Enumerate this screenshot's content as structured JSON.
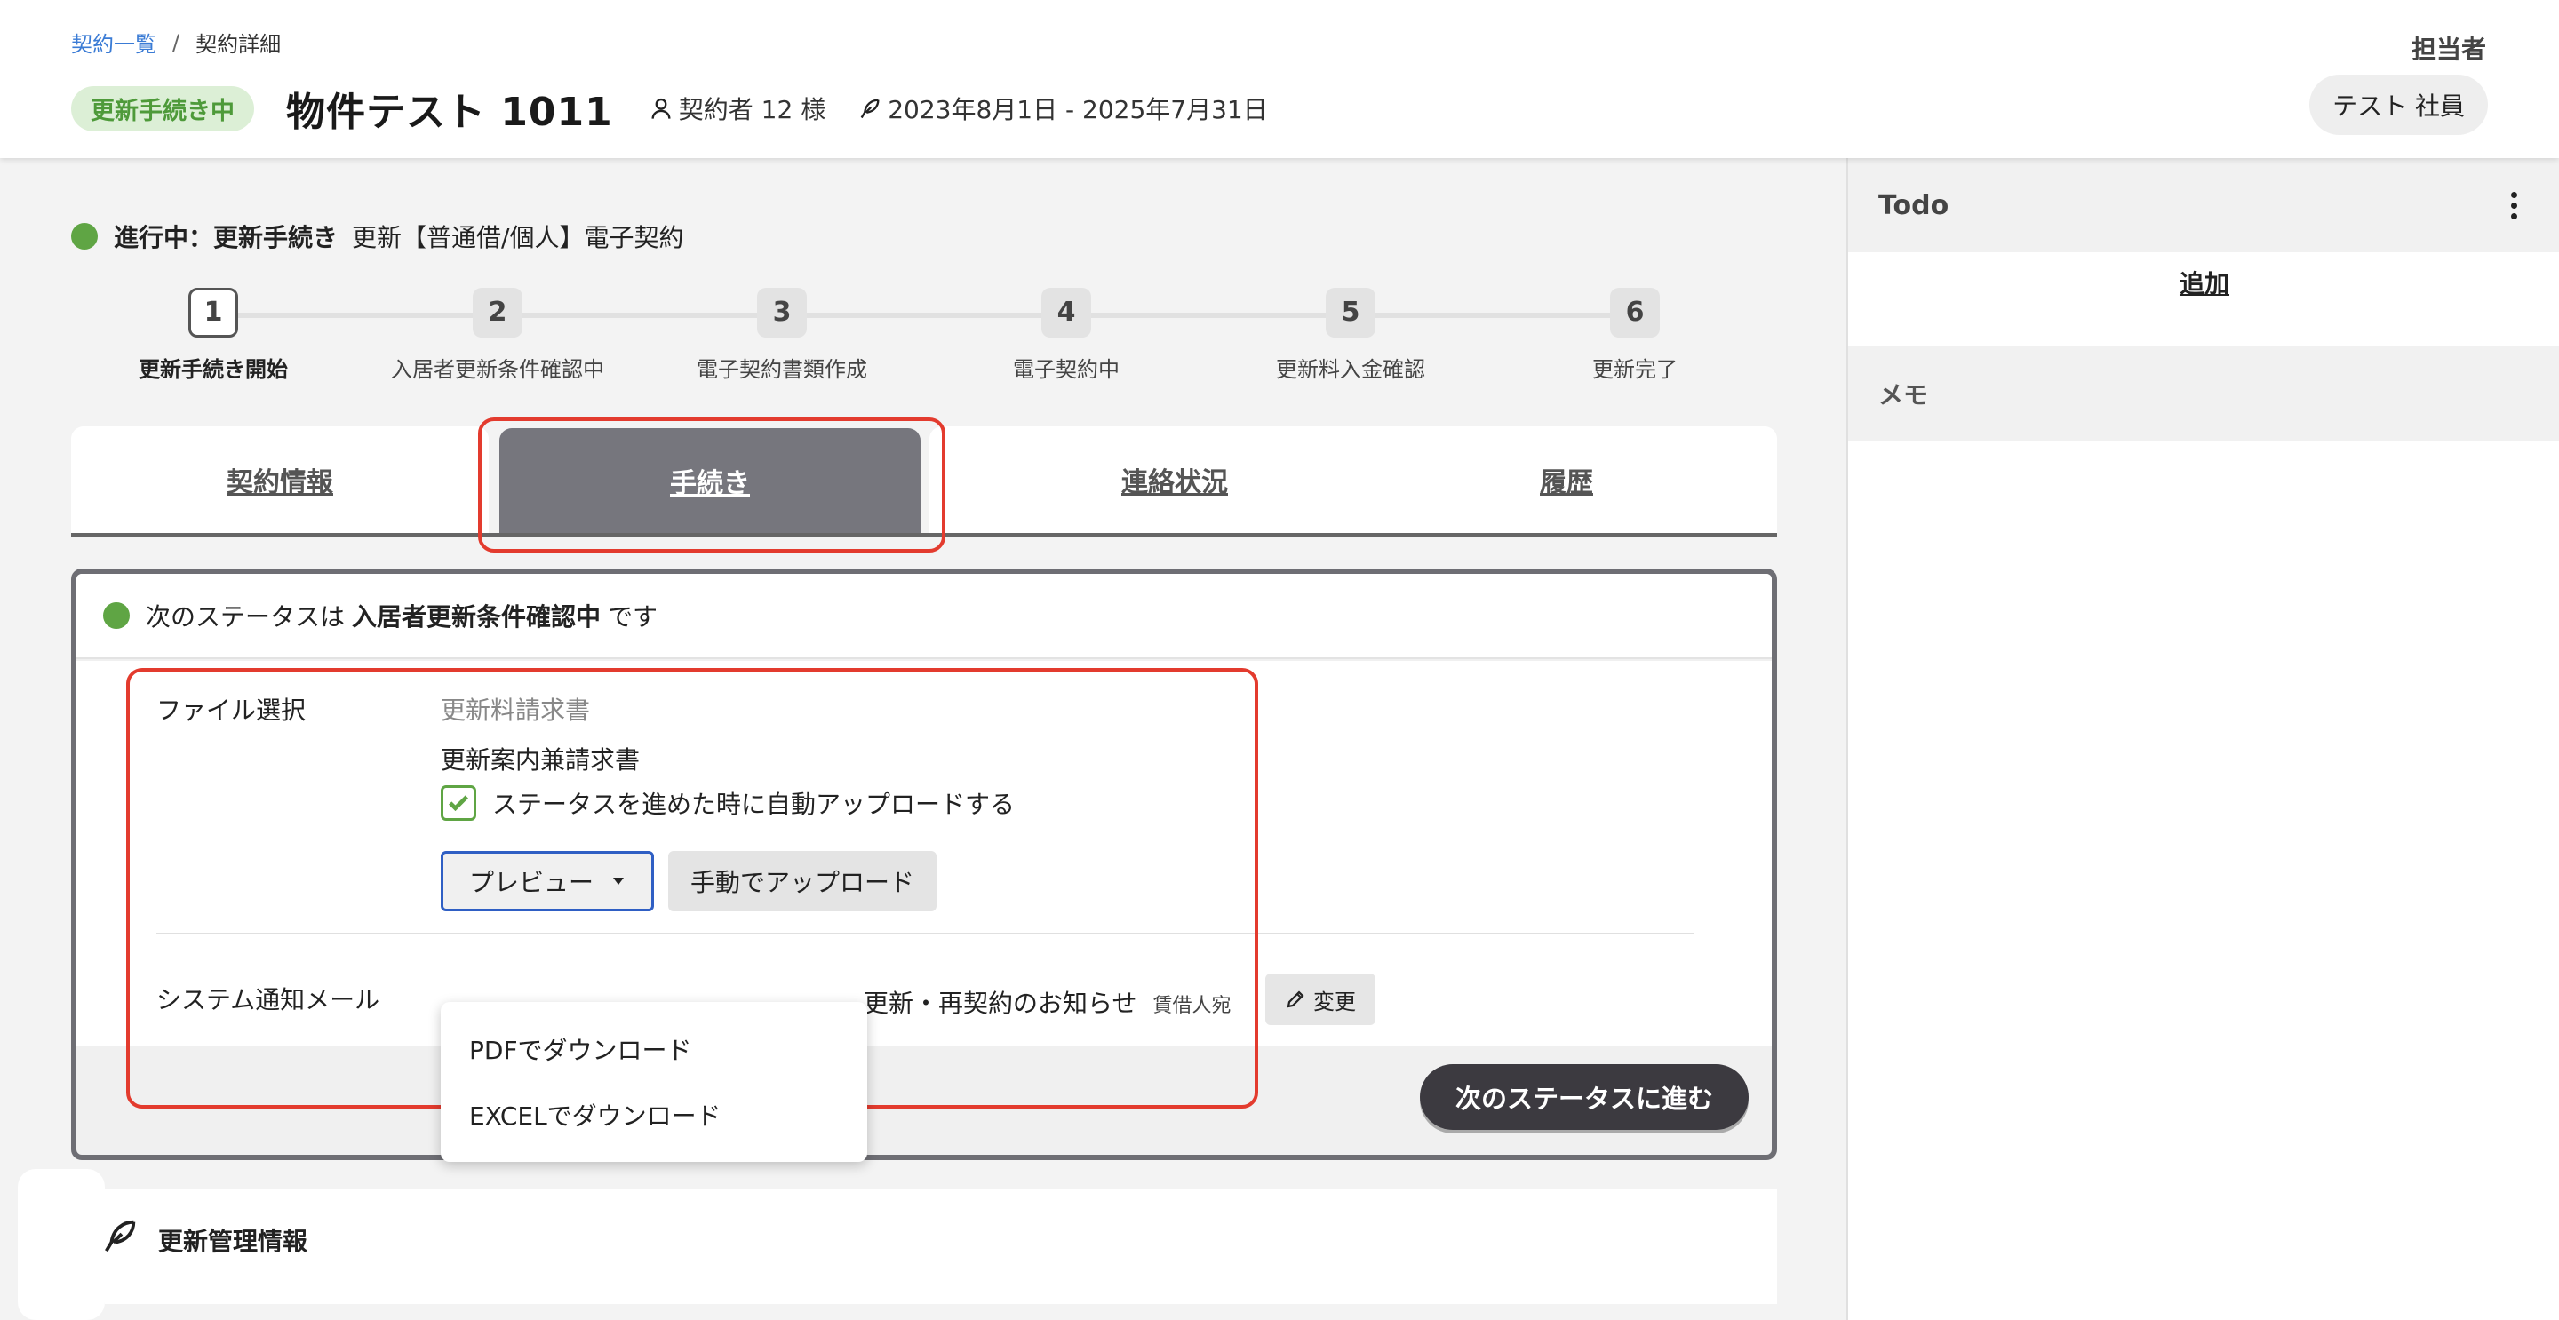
{
  "breadcrumb": {
    "parent": "契約一覧",
    "separator": "/",
    "current": "契約詳細"
  },
  "header": {
    "status_badge": "更新手続き中",
    "title": "物件テスト 1011",
    "contractors": "契約者 12 様",
    "period": "2023年8月1日 - 2025年7月31日",
    "assignee_label": "担当者",
    "assignee_name": "テスト 社員"
  },
  "progress": {
    "status_bold": "進行中：更新手続き",
    "status_text": "更新【普通借/個人】電子契約",
    "status_color": "#5fa544",
    "steps": [
      {
        "num": "1",
        "label": "更新手続き開始"
      },
      {
        "num": "2",
        "label": "入居者更新条件確認中"
      },
      {
        "num": "3",
        "label": "電子契約書類作成"
      },
      {
        "num": "4",
        "label": "電子契約中"
      },
      {
        "num": "5",
        "label": "更新料入金確認"
      },
      {
        "num": "6",
        "label": "更新完了"
      }
    ],
    "current_step": 1
  },
  "tabs": [
    {
      "label": "契約情報"
    },
    {
      "label": "手続き"
    },
    {
      "label": "連絡状況"
    },
    {
      "label": "履歴"
    }
  ],
  "active_tab": "手続き",
  "panel": {
    "next_prefix": "次のステータスは",
    "next_status": "入居者更新条件確認中",
    "next_suffix": "です",
    "file_label": "ファイル選択",
    "file_category": "更新料請求書",
    "file_name": "更新案内兼請求書",
    "auto_upload_label": "ステータスを進めた時に自動アップロードする",
    "auto_upload_checked": true,
    "preview_button": "プレビュー",
    "manual_upload_button": "手動でアップロード",
    "dropdown_items": [
      "PDFでダウンロード",
      "EXCELでダウンロード"
    ],
    "mail_label": "システム通知メール",
    "mail_value": "更新・再契約のお知らせ",
    "mail_target": "賃借人宛",
    "change_button": "変更",
    "next_button": "次のステータスに進む"
  },
  "management": {
    "title": "更新管理情報"
  },
  "sidebar": {
    "todo_title": "Todo",
    "todo_add": "追加",
    "memo_title": "メモ"
  },
  "colors": {
    "accent_red": "#e33b2e",
    "link_blue": "#3a7bd5",
    "active_tab": "#76767d"
  }
}
